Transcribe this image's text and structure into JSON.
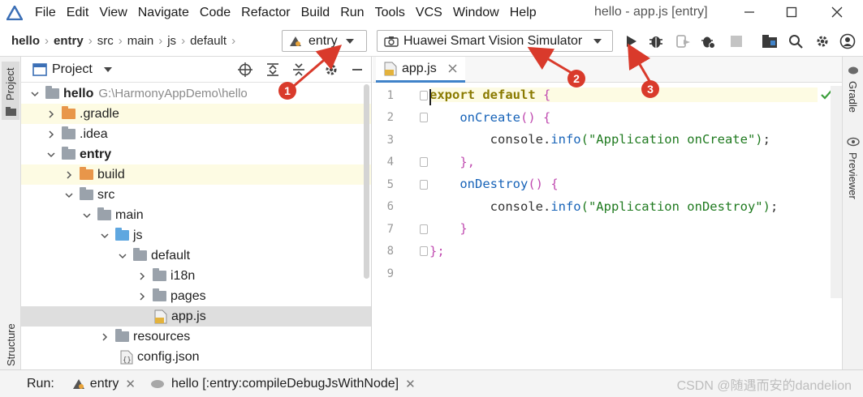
{
  "menu": {
    "items": [
      "File",
      "Edit",
      "View",
      "Navigate",
      "Code",
      "Refactor",
      "Build",
      "Run",
      "Tools",
      "VCS",
      "Window",
      "Help"
    ],
    "window_title": "hello - app.js [entry]"
  },
  "toolbar": {
    "breadcrumbs": [
      "hello",
      "entry",
      "src",
      "main",
      "js",
      "default"
    ],
    "module_combo": "entry",
    "device_combo": "Huawei Smart Vision Simulator"
  },
  "left_strip": {
    "project_label": "Project",
    "structure_label": "Structure"
  },
  "project_panel": {
    "title": "Project",
    "tree": [
      {
        "label": "hello",
        "hint": "G:\\HarmonyAppDemo\\hello"
      },
      {
        "label": ".gradle"
      },
      {
        "label": ".idea"
      },
      {
        "label": "entry"
      },
      {
        "label": "build"
      },
      {
        "label": "src"
      },
      {
        "label": "main"
      },
      {
        "label": "js"
      },
      {
        "label": "default"
      },
      {
        "label": "i18n"
      },
      {
        "label": "pages"
      },
      {
        "label": "app.js"
      },
      {
        "label": "resources"
      },
      {
        "label": "config.json"
      }
    ]
  },
  "editor": {
    "tab_label": "app.js",
    "line_numbers": [
      "1",
      "2",
      "3",
      "4",
      "5",
      "6",
      "7",
      "8",
      "9"
    ],
    "code": {
      "l1_kw": "export default",
      "l1_br": " {",
      "l2_fn": "onCreate",
      "l2_br": "() {",
      "l3_obj": "console.",
      "l3_fn": "info",
      "l3_str": "(\"Application onCreate\")",
      "l3_end": ";",
      "l4": "},",
      "l5_fn": "onDestroy",
      "l5_br": "() {",
      "l6_obj": "console.",
      "l6_fn": "info",
      "l6_str": "(\"Application onDestroy\")",
      "l6_end": ";",
      "l7": "}",
      "l8": "};"
    }
  },
  "right_strip": {
    "gradle_label": "Gradle",
    "previewer_label": "Previewer"
  },
  "runbar": {
    "run_label": "Run:",
    "tab1": "entry",
    "tab2": "hello [:entry:compileDebugJsWithNode]"
  },
  "watermark": "CSDN @随遇而安的dandelion",
  "annotations": {
    "badges": [
      "1",
      "2",
      "3"
    ],
    "color": "#d93a2b"
  },
  "colors": {
    "accent": "#4083c9",
    "folder_orange": "#e8964a",
    "folder_blue": "#5fa7e0",
    "folder_gray": "#9aa2ab",
    "highlight": "#fdfbe3"
  }
}
